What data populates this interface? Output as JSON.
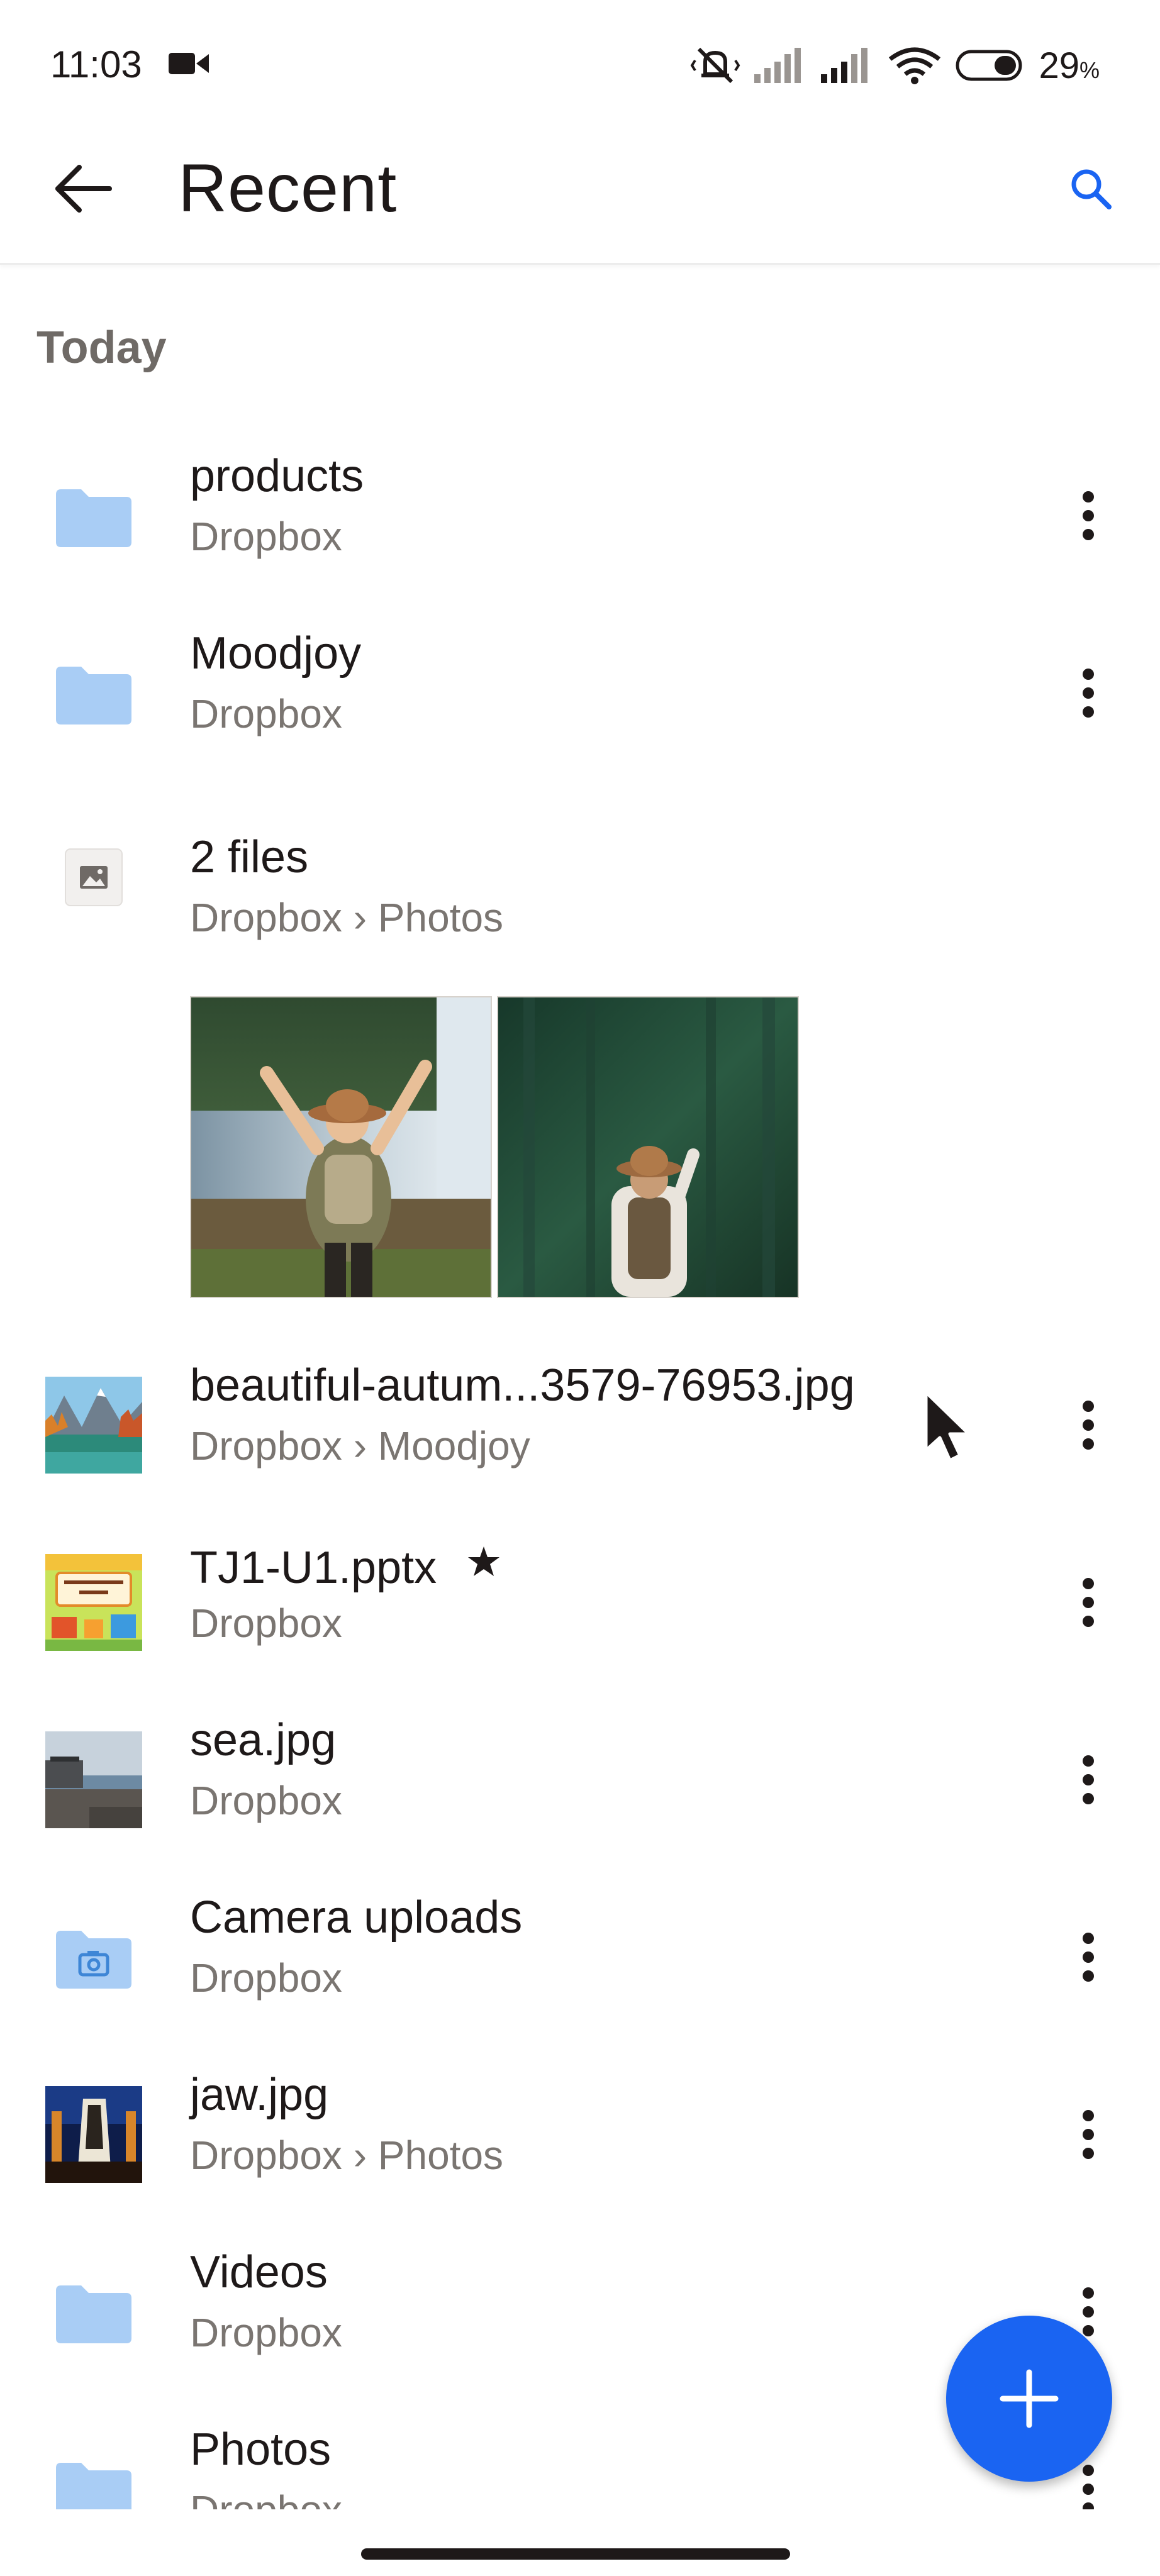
{
  "status_bar": {
    "time": "11:03",
    "battery_percent": "29",
    "battery_suffix": "%"
  },
  "app_bar": {
    "title": "Recent"
  },
  "section": {
    "title": "Today"
  },
  "items": [
    {
      "name": "products",
      "path": "Dropbox",
      "icon": "folder-icon"
    },
    {
      "name": "Moodjoy",
      "path": "Dropbox",
      "icon": "folder-icon"
    },
    {
      "name": "2 files",
      "path": "Dropbox › Photos",
      "icon": "image-file-icon"
    },
    {
      "name": "beautiful-autum...3579-76953.jpg",
      "path": "Dropbox › Moodjoy",
      "icon": "image-thumbnail"
    },
    {
      "name": "TJ1-U1.pptx",
      "path": "Dropbox",
      "icon": "presentation-thumbnail",
      "starred": true
    },
    {
      "name": "sea.jpg",
      "path": "Dropbox",
      "icon": "image-thumbnail"
    },
    {
      "name": "Camera uploads",
      "path": "Dropbox",
      "icon": "camera-folder-icon"
    },
    {
      "name": "jaw.jpg",
      "path": "Dropbox › Photos",
      "icon": "image-thumbnail"
    },
    {
      "name": "Videos",
      "path": "Dropbox",
      "icon": "folder-icon"
    },
    {
      "name": "Photos",
      "path": "Dropbox",
      "icon": "folder-icon"
    }
  ],
  "colors": {
    "accent": "#1a64f2",
    "folder": "#a9cdf5",
    "text_primary": "#1e1919",
    "text_secondary": "#7a7571"
  }
}
